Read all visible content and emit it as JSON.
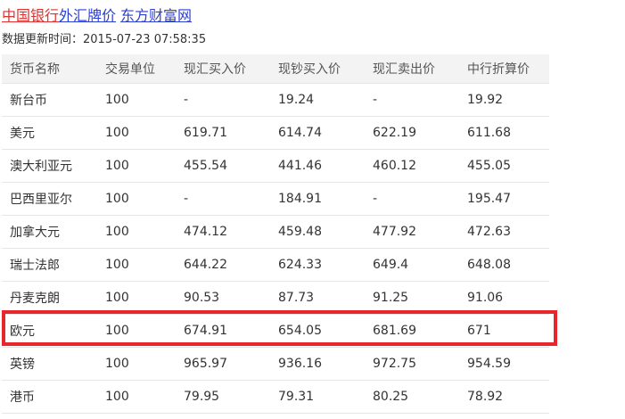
{
  "header": {
    "title_link_1": "中国银行",
    "title_link_2": "外汇牌价",
    "title_link_3": "东方财富网",
    "link_colors": {
      "red": "#e03030",
      "blue": "#2c3fd4"
    }
  },
  "update_info": {
    "label": "数据更新时间：",
    "timestamp": "2015-07-23 07:58:35"
  },
  "table": {
    "columns": [
      "货币名称",
      "交易单位",
      "现汇买入价",
      "现钞买入价",
      "现汇卖出价",
      "中行折算价"
    ],
    "rows": [
      [
        "新台币",
        "100",
        "-",
        "19.24",
        "-",
        "19.92"
      ],
      [
        "美元",
        "100",
        "619.71",
        "614.74",
        "622.19",
        "611.68"
      ],
      [
        "澳大利亚元",
        "100",
        "455.54",
        "441.46",
        "460.12",
        "455.05"
      ],
      [
        "巴西里亚尔",
        "100",
        "-",
        "184.91",
        "-",
        "195.47"
      ],
      [
        "加拿大元",
        "100",
        "474.12",
        "459.48",
        "477.92",
        "472.63"
      ],
      [
        "瑞士法郎",
        "100",
        "644.22",
        "624.33",
        "649.4",
        "648.08"
      ],
      [
        "丹麦克朗",
        "100",
        "90.53",
        "87.73",
        "91.25",
        "91.06"
      ],
      [
        "欧元",
        "100",
        "674.91",
        "654.05",
        "681.69",
        "671"
      ],
      [
        "英镑",
        "100",
        "965.97",
        "936.16",
        "972.75",
        "954.59"
      ],
      [
        "港币",
        "100",
        "79.95",
        "79.31",
        "80.25",
        "78.92"
      ]
    ],
    "highlighted_row": "欧元",
    "highlight_color": "#e8262b"
  }
}
